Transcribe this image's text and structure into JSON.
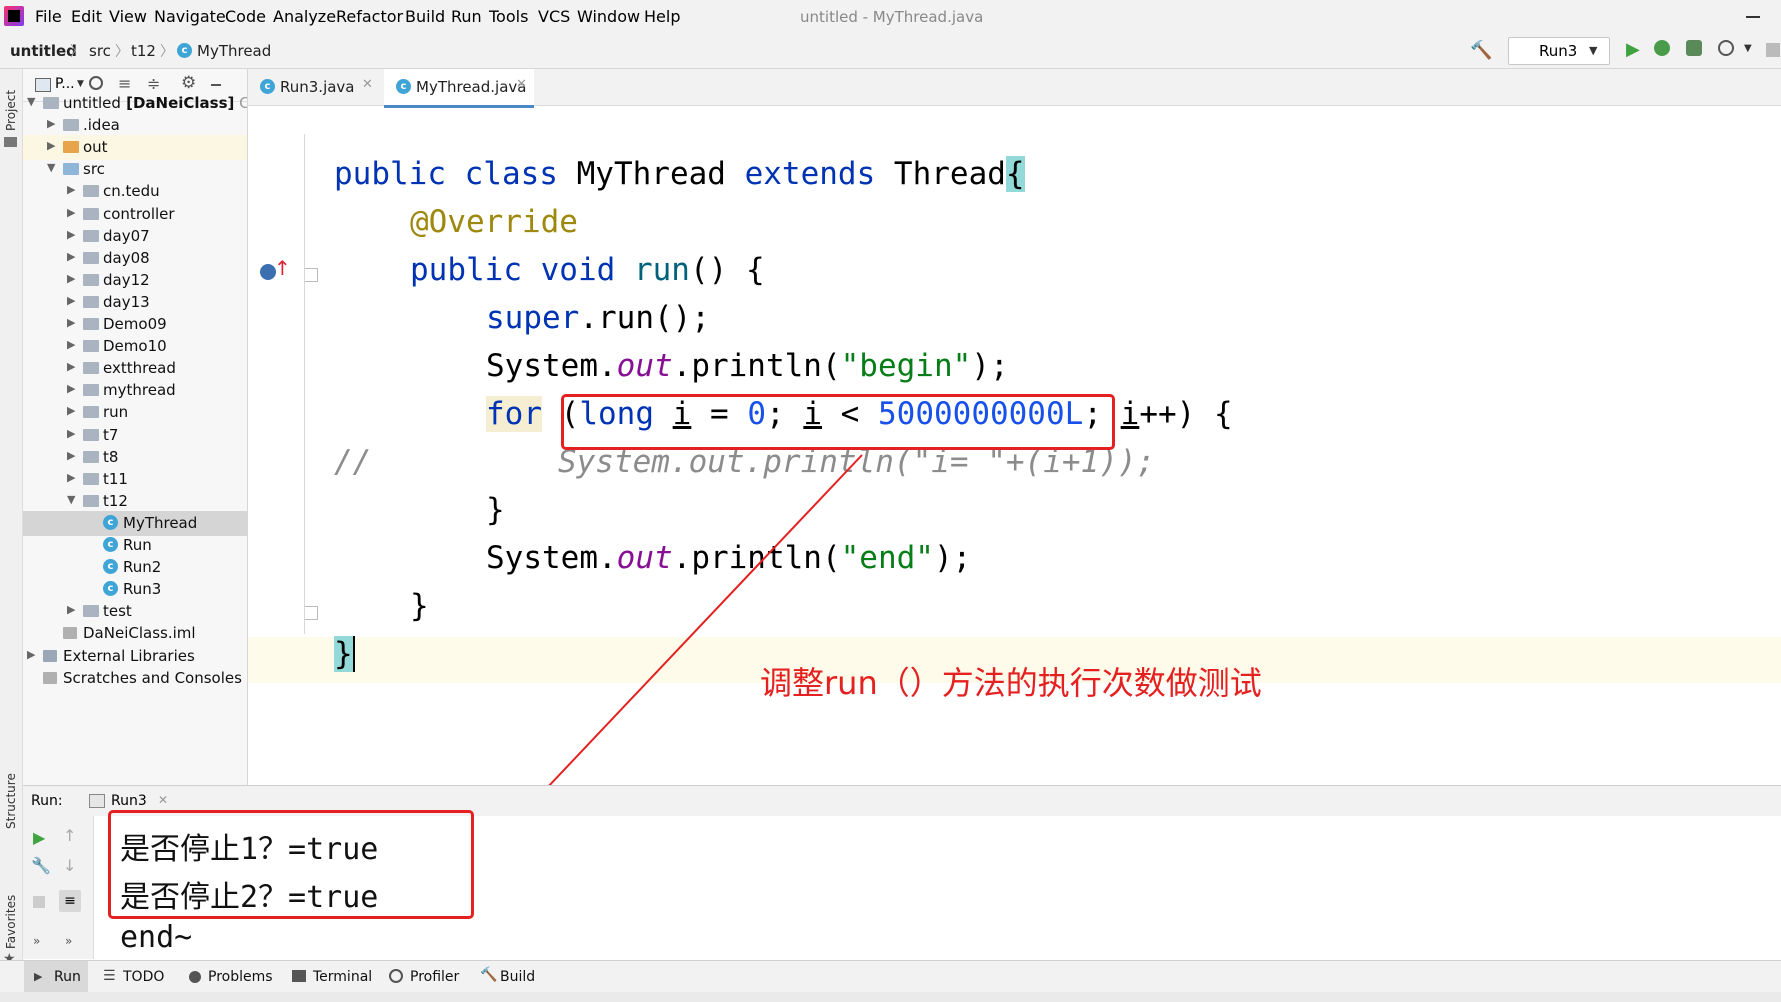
{
  "menu": {
    "items": [
      "File",
      "Edit",
      "View",
      "Navigate",
      "Code",
      "Analyze",
      "Refactor",
      "Build",
      "Run",
      "Tools",
      "VCS",
      "Window",
      "Help"
    ],
    "window_title": "untitled - MyThread.java"
  },
  "navbar": {
    "crumbs": [
      "untitled",
      "src",
      "t12",
      "MyThread"
    ],
    "run_config": "Run3"
  },
  "sidebar": {
    "stripe_labels": [
      "Project",
      "Structure",
      "Favorites"
    ],
    "toolbar_label": "P...",
    "tree": [
      {
        "label": "untitled",
        "suffix": "[DaNeiClass]",
        "extra": "C:",
        "indent": 0,
        "arrow": "▼",
        "icon": "folder"
      },
      {
        "label": ".idea",
        "indent": 1,
        "arrow": "▶",
        "icon": "folder"
      },
      {
        "label": "out",
        "indent": 1,
        "arrow": "▶",
        "icon": "folder-orange",
        "hl": true
      },
      {
        "label": "src",
        "indent": 1,
        "arrow": "▼",
        "icon": "folder-blue"
      },
      {
        "label": "cn.tedu",
        "indent": 2,
        "arrow": "▶",
        "icon": "folder"
      },
      {
        "label": "controller",
        "indent": 2,
        "arrow": "▶",
        "icon": "folder"
      },
      {
        "label": "day07",
        "indent": 2,
        "arrow": "▶",
        "icon": "folder"
      },
      {
        "label": "day08",
        "indent": 2,
        "arrow": "▶",
        "icon": "folder"
      },
      {
        "label": "day12",
        "indent": 2,
        "arrow": "▶",
        "icon": "folder"
      },
      {
        "label": "day13",
        "indent": 2,
        "arrow": "▶",
        "icon": "folder"
      },
      {
        "label": "Demo09",
        "indent": 2,
        "arrow": "▶",
        "icon": "folder"
      },
      {
        "label": "Demo10",
        "indent": 2,
        "arrow": "▶",
        "icon": "folder"
      },
      {
        "label": "extthread",
        "indent": 2,
        "arrow": "▶",
        "icon": "folder"
      },
      {
        "label": "mythread",
        "indent": 2,
        "arrow": "▶",
        "icon": "folder"
      },
      {
        "label": "run",
        "indent": 2,
        "arrow": "▶",
        "icon": "folder"
      },
      {
        "label": "t7",
        "indent": 2,
        "arrow": "▶",
        "icon": "folder"
      },
      {
        "label": "t8",
        "indent": 2,
        "arrow": "▶",
        "icon": "folder"
      },
      {
        "label": "t11",
        "indent": 2,
        "arrow": "▶",
        "icon": "folder"
      },
      {
        "label": "t12",
        "indent": 2,
        "arrow": "▼",
        "icon": "folder"
      },
      {
        "label": "MyThread",
        "indent": 3,
        "arrow": "",
        "icon": "class",
        "selected": true
      },
      {
        "label": "Run",
        "indent": 3,
        "arrow": "",
        "icon": "class"
      },
      {
        "label": "Run2",
        "indent": 3,
        "arrow": "",
        "icon": "class"
      },
      {
        "label": "Run3",
        "indent": 3,
        "arrow": "",
        "icon": "class"
      },
      {
        "label": "test",
        "indent": 2,
        "arrow": "▶",
        "icon": "folder"
      },
      {
        "label": "DaNeiClass.iml",
        "indent": 1,
        "arrow": "",
        "icon": "file"
      },
      {
        "label": "External Libraries",
        "indent": 0,
        "arrow": "▶",
        "icon": "lib"
      },
      {
        "label": "Scratches and Consoles",
        "indent": 0,
        "arrow": "",
        "icon": "scratch"
      }
    ]
  },
  "editor": {
    "tabs": [
      {
        "label": "Run3.java",
        "active": false
      },
      {
        "label": "MyThread.java",
        "active": true
      }
    ]
  },
  "annotation": {
    "text": "调整run（）方法的执行次数做测试",
    "color": "#e52020"
  },
  "run_panel": {
    "title": "Run:",
    "tab": "Run3",
    "output": [
      "是否停止1？=true",
      "是否停止2？=true",
      "end~"
    ]
  },
  "bottom_bar": {
    "tabs": [
      "Run",
      "TODO",
      "Problems",
      "Terminal",
      "Profiler",
      "Build"
    ]
  }
}
